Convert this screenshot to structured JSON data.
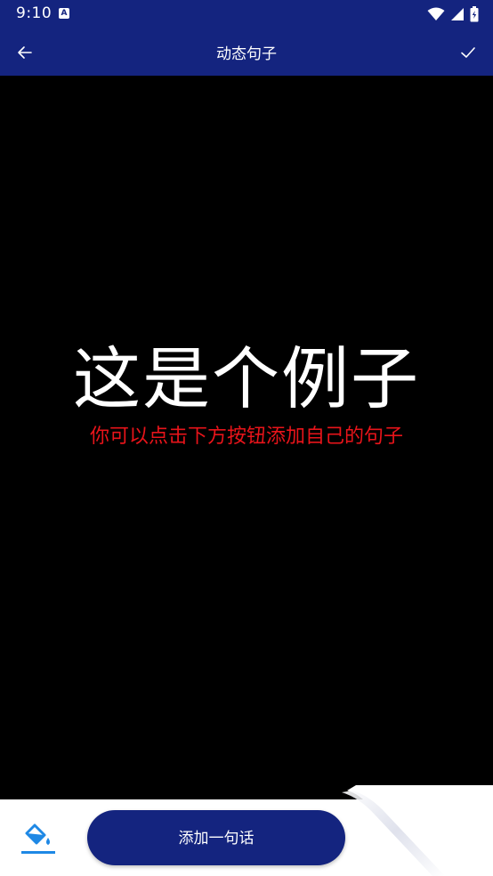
{
  "status_bar": {
    "time": "9:10",
    "notification_icon": "A"
  },
  "app_bar": {
    "title": "动态句子",
    "back_icon": "arrow-left-icon",
    "confirm_icon": "check-icon"
  },
  "canvas": {
    "main_sentence": "这是个例子",
    "sub_sentence": "你可以点击下方按钮添加自己的句子",
    "main_color": "#ffffff",
    "sub_color": "#e8141a"
  },
  "bottom_bar": {
    "paint_icon": "paint-bucket-icon",
    "add_button_label": "添加一句话"
  },
  "colors": {
    "primary": "#14247f",
    "accent": "#1e88e5",
    "background": "#000000"
  }
}
